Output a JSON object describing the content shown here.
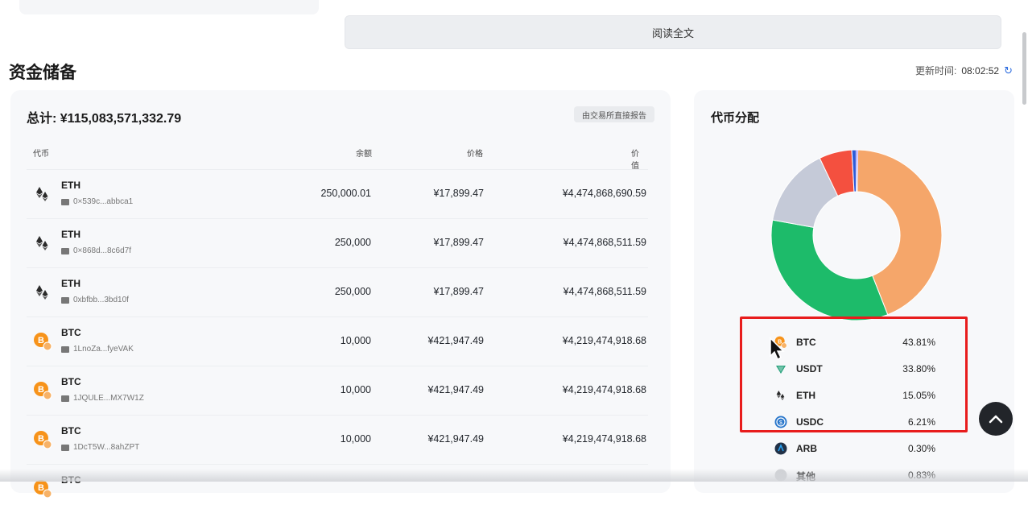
{
  "read_more": "阅读全文",
  "section_title": "资金储备",
  "update": {
    "label": "更新时间:",
    "time": "08:02:52"
  },
  "reserve": {
    "total": "总计: ¥115,083,571,332.79",
    "badge": "由交易所直接报告",
    "headers": {
      "coin": "代币",
      "balance": "余额",
      "price": "价格",
      "value": "价值"
    },
    "rows": [
      {
        "icon": "eth-icon",
        "symbol": "ETH",
        "address": "0×539c...abbca1",
        "balance": "250,000.01",
        "price": "¥17,899.47",
        "value": "¥4,474,868,690.59"
      },
      {
        "icon": "eth-icon",
        "symbol": "ETH",
        "address": "0×868d...8c6d7f",
        "balance": "250,000",
        "price": "¥17,899.47",
        "value": "¥4,474,868,511.59"
      },
      {
        "icon": "eth-icon",
        "symbol": "ETH",
        "address": "0xbfbb...3bd10f",
        "balance": "250,000",
        "price": "¥17,899.47",
        "value": "¥4,474,868,511.59"
      },
      {
        "icon": "btc-icon",
        "symbol": "BTC",
        "address": "1LnoZa...fyeVAK",
        "balance": "10,000",
        "price": "¥421,947.49",
        "value": "¥4,219,474,918.68"
      },
      {
        "icon": "btc-icon",
        "symbol": "BTC",
        "address": "1JQULE...MX7W1Z",
        "balance": "10,000",
        "price": "¥421,947.49",
        "value": "¥4,219,474,918.68"
      },
      {
        "icon": "btc-icon",
        "symbol": "BTC",
        "address": "1DcT5W...8ahZPT",
        "balance": "10,000",
        "price": "¥421,947.49",
        "value": "¥4,219,474,918.68"
      },
      {
        "icon": "btc-icon",
        "symbol": "BTC",
        "address": "",
        "balance": "",
        "price": "",
        "value": ""
      }
    ]
  },
  "distribution": {
    "title": "代币分配",
    "items": [
      {
        "name": "BTC",
        "pct": "43.81%",
        "value": 43.81,
        "color": "#f5a66a",
        "icon": "btc-icon"
      },
      {
        "name": "USDT",
        "pct": "33.80%",
        "value": 33.8,
        "color": "#1dbb6a",
        "icon": "usdt-icon"
      },
      {
        "name": "ETH",
        "pct": "15.05%",
        "value": 15.05,
        "color": "#c5cad8",
        "icon": "eth-icon"
      },
      {
        "name": "USDC",
        "pct": "6.21%",
        "value": 6.21,
        "color": "#f4503f",
        "icon": "usdc-icon"
      },
      {
        "name": "ARB",
        "pct": "0.30%",
        "value": 0.3,
        "color": "#5b3df5",
        "icon": "arb-icon"
      },
      {
        "name": "其他",
        "pct": "0.83%",
        "value": 0.83,
        "color": "#2f5bd8",
        "icon": "other-icon"
      }
    ]
  }
}
